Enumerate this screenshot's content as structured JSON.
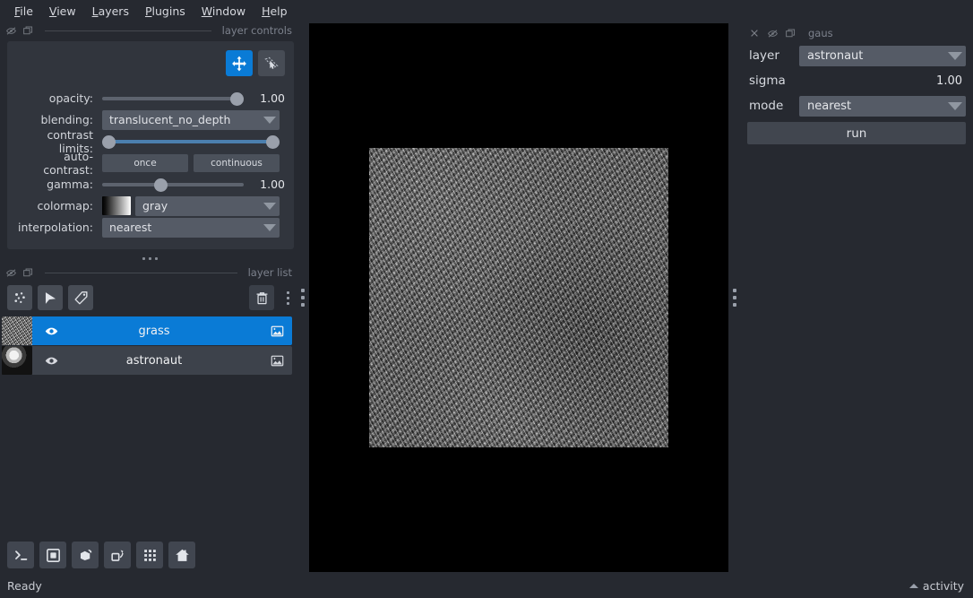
{
  "app": {
    "window_title": "napari",
    "background_color": "#262930",
    "accent_color": "#0a7bd6",
    "panel_color": "#31353d"
  },
  "menubar": {
    "items": [
      {
        "label": "File",
        "mnemonic": "F"
      },
      {
        "label": "View",
        "mnemonic": "V"
      },
      {
        "label": "Layers",
        "mnemonic": "L"
      },
      {
        "label": "Plugins",
        "mnemonic": "P"
      },
      {
        "label": "Window",
        "mnemonic": "W"
      },
      {
        "label": "Help",
        "mnemonic": "H"
      }
    ]
  },
  "layer_controls": {
    "dock_title": "layer controls",
    "dock_icons": [
      "hide-icon",
      "float-icon"
    ],
    "mode_buttons": [
      {
        "name": "pan-zoom-mode-button",
        "icon": "pan-arrows-icon",
        "active": true
      },
      {
        "name": "transform-mode-button",
        "icon": "transform-icon",
        "active": false
      }
    ],
    "rows": {
      "opacity": {
        "label": "opacity:",
        "value": "1.00",
        "percent": 100
      },
      "blending": {
        "label": "blending:",
        "value": "translucent_no_depth"
      },
      "contrast_limits": {
        "label": "contrast limits:",
        "low_percent": 0,
        "high_percent": 100
      },
      "auto_contrast": {
        "label": "auto-contrast:",
        "once": "once",
        "continuous": "continuous"
      },
      "gamma": {
        "label": "gamma:",
        "value": "1.00",
        "percent": 37
      },
      "colormap": {
        "label": "colormap:",
        "value": "gray",
        "swatch": "black-to-white-gradient"
      },
      "interpolation": {
        "label": "interpolation:",
        "value": "nearest"
      }
    }
  },
  "layer_list": {
    "dock_title": "layer list",
    "dock_icons": [
      "hide-icon",
      "float-icon"
    ],
    "toolbar": [
      {
        "name": "new-points-layer-button",
        "icon": "points-icon"
      },
      {
        "name": "new-shapes-layer-button",
        "icon": "shapes-icon"
      },
      {
        "name": "new-labels-layer-button",
        "icon": "labels-tag-icon"
      }
    ],
    "delete_button": {
      "name": "delete-layer-button",
      "icon": "trash-icon"
    },
    "overflow_button": {
      "name": "layer-list-menu-button",
      "icon": "kebab-icon"
    },
    "layers": [
      {
        "name": "grass",
        "visible": true,
        "selected": true,
        "type_icon": "image-layer-icon",
        "thumbnail": "grass-thumbnail"
      },
      {
        "name": "astronaut",
        "visible": true,
        "selected": false,
        "type_icon": "image-layer-icon",
        "thumbnail": "astronaut-thumbnail"
      }
    ]
  },
  "viewer_buttons": [
    {
      "name": "console-button",
      "icon": "console-prompt-icon"
    },
    {
      "name": "ndisplay-2d-button",
      "icon": "square-2d-icon"
    },
    {
      "name": "ndisplay-3d-button",
      "icon": "cube-3d-icon"
    },
    {
      "name": "roll-dims-button",
      "icon": "roll-dimensions-icon"
    },
    {
      "name": "grid-view-button",
      "icon": "grid-icon"
    },
    {
      "name": "reset-view-button",
      "icon": "home-icon"
    }
  ],
  "canvas": {
    "background_color": "#000000",
    "active_layer_name": "grass",
    "image_description": "grayscale grass texture"
  },
  "splitters": [
    {
      "name": "left-panel-splitter-handle",
      "icon": "grip-dots-icon"
    },
    {
      "name": "right-panel-splitter-handle",
      "icon": "grip-dots-icon"
    },
    {
      "name": "layer-controls-splitter-handle",
      "icon": "grip-dots-icon"
    }
  ],
  "plugin_dock": {
    "title": "gaus",
    "dock_icons": [
      "close-icon",
      "hide-icon",
      "float-icon"
    ],
    "fields": {
      "layer": {
        "label": "layer",
        "value": "astronaut"
      },
      "sigma": {
        "label": "sigma",
        "value": "1.00",
        "percent": 18
      },
      "mode": {
        "label": "mode",
        "value": "nearest"
      }
    },
    "run_button": "run"
  },
  "statusbar": {
    "status": "Ready",
    "activity_label": "activity",
    "activity_icon": "caret-up-icon"
  }
}
